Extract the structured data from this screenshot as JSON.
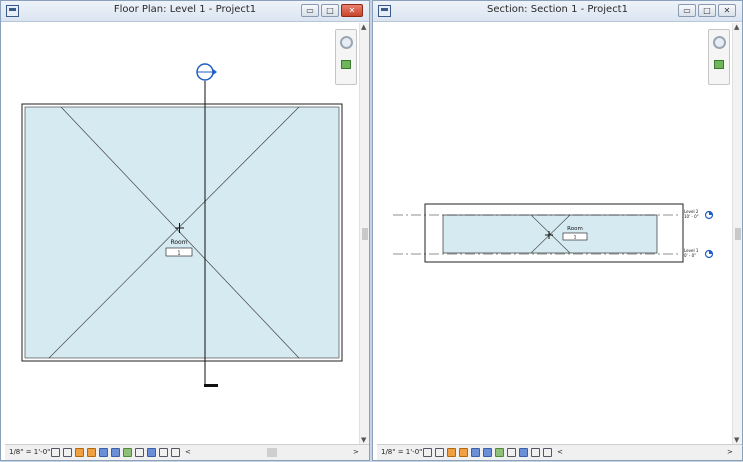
{
  "windows": [
    {
      "title": "Floor Plan: Level 1 - Project1",
      "scale": "1/8\" = 1'-0\"",
      "room": {
        "name": "Room",
        "number": "1"
      },
      "buttons": {
        "minimize": "▭",
        "restore": "□",
        "close": "✕"
      }
    },
    {
      "title": "Section: Section 1 - Project1",
      "scale": "1/8\" = 1'-0\"",
      "room": {
        "name": "Room",
        "number": "1"
      },
      "levels": [
        {
          "name": "Level 2",
          "elevation": "10' - 0\""
        },
        {
          "name": "Level 1",
          "elevation": "0' - 0\""
        }
      ],
      "buttons": {
        "minimize": "▭",
        "restore": "□",
        "close": "✕"
      }
    }
  ],
  "colors": {
    "room_fill": "#d6eaf2",
    "titlebar": "#dbe5f1",
    "level_marker": "#1f5fc4"
  },
  "scrollbar": {
    "up": "▲",
    "down": "▼",
    "left": "<",
    "right": ">"
  }
}
